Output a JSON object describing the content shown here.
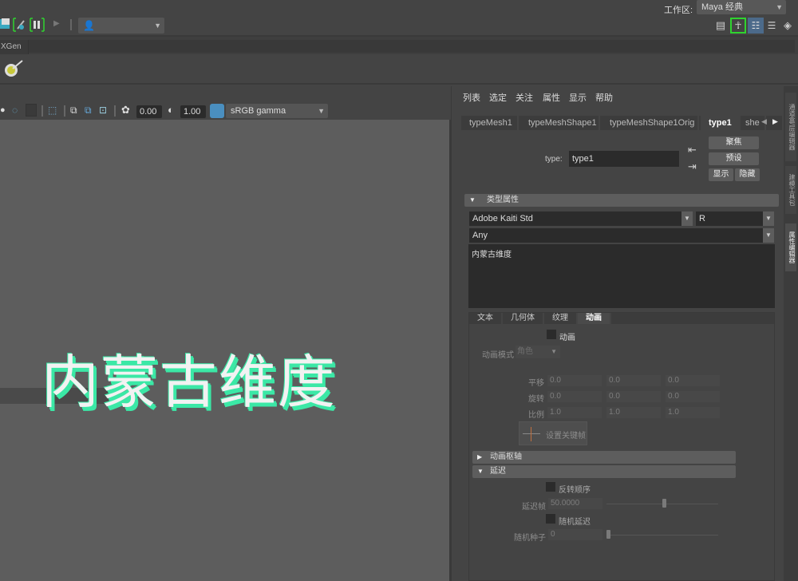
{
  "topbar": {
    "workspace_label": "工作区:",
    "workspace_value": "Maya 经典",
    "user_dropdown_value": ""
  },
  "shelf": {
    "tab_label": "XGen"
  },
  "viewport_toolbar": {
    "exposure_value": "0.00",
    "gamma_value": "1.00",
    "color_space": "sRGB gamma"
  },
  "viewport": {
    "text_3d": "内蒙古维度",
    "text_color": "#3be8a6"
  },
  "ae": {
    "menu": [
      "列表",
      "选定",
      "关注",
      "属性",
      "显示",
      "帮助"
    ],
    "node_tabs": [
      "typeMesh1",
      "typeMeshShape1",
      "typeMeshShape1Orig",
      "type1",
      "she"
    ],
    "active_node_tab": "type1",
    "type_label": "type:",
    "type_value": "type1",
    "buttons": {
      "focus": "聚焦",
      "presets": "预设",
      "show": "显示",
      "hide": "隐藏"
    },
    "type_attributes": {
      "header": "类型属性",
      "font": "Adobe Kaiti Std",
      "style": "R",
      "writing_system": "Any",
      "text": "内蒙古维度"
    },
    "sub_tabs": [
      "文本",
      "几何体",
      "纹理",
      "动画"
    ],
    "active_sub_tab": "动画",
    "animation": {
      "animate_label": "动画",
      "animate_checked": false,
      "mode_label": "动画模式",
      "mode_value": "角色",
      "rows": [
        {
          "label": "平移",
          "values": [
            "0.0",
            "0.0",
            "0.0"
          ]
        },
        {
          "label": "旋转",
          "values": [
            "0.0",
            "0.0",
            "0.0"
          ]
        },
        {
          "label": "比例",
          "values": [
            "1.0",
            "1.0",
            "1.0"
          ]
        }
      ],
      "set_key_label": "设置关键帧"
    },
    "pivot_header": "动画枢轴",
    "delay": {
      "header": "延迟",
      "reverse_label": "反转顺序",
      "reverse_checked": false,
      "delay_frames_label": "延迟帧",
      "delay_frames_value": "50.0000",
      "delay_frames_slider": 0.5,
      "random_delay_label": "随机延迟",
      "random_delay_checked": false,
      "random_seed_label": "随机种子",
      "random_seed_value": "0",
      "random_seed_slider": 0.0
    }
  },
  "rail": {
    "tabs": [
      "通道盒/层编辑器",
      "建模工具包",
      "属性编辑器"
    ],
    "active": "属性编辑器"
  }
}
